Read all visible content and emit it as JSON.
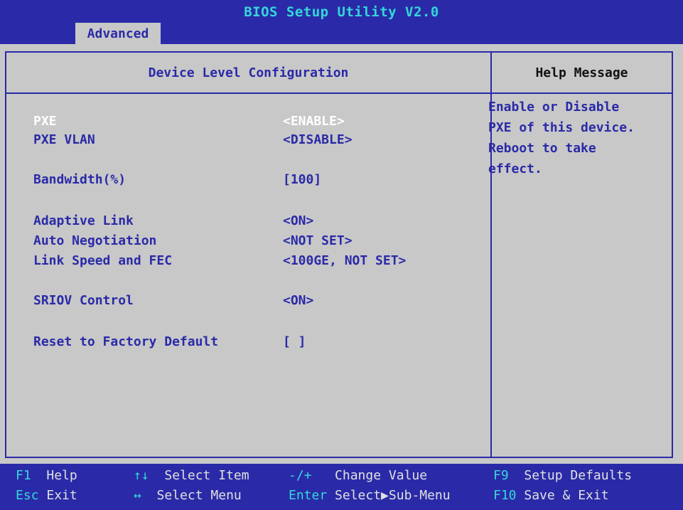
{
  "header": {
    "title": "BIOS Setup Utility V2.0",
    "active_tab": "Advanced"
  },
  "panel": {
    "title": "Device Level Configuration",
    "help_title": "Help Message",
    "help_lines": [
      "Enable or Disable",
      "PXE of this device.",
      "Reboot to take",
      "effect."
    ]
  },
  "settings": [
    {
      "label": "PXE",
      "value": "<ENABLE>"
    },
    {
      "label": "PXE VLAN",
      "value": "<DISABLE>"
    },
    {
      "label": "Bandwidth(%)",
      "value": "[100]"
    },
    {
      "label": "Adaptive Link",
      "value": "<ON>"
    },
    {
      "label": "Auto Negotiation",
      "value": "<NOT SET>"
    },
    {
      "label": "Link Speed and FEC",
      "value": "<100GE, NOT SET>"
    },
    {
      "label": "SRIOV Control",
      "value": "<ON>"
    },
    {
      "label": "Reset to Factory Default",
      "value": "[ ]"
    }
  ],
  "footer": [
    {
      "key": "F1",
      "desc": "Help"
    },
    {
      "key": "Esc",
      "desc": "Exit"
    },
    {
      "key": "↑↓",
      "desc": "Select Item"
    },
    {
      "key": "↔",
      "desc": "Select Menu"
    },
    {
      "key": "-/+",
      "desc": "Change Value"
    },
    {
      "key": "Enter",
      "desc": "Select▶Sub-Menu"
    },
    {
      "key": "F9",
      "desc": "Setup Defaults"
    },
    {
      "key": "F10",
      "desc": "Save & Exit"
    }
  ],
  "colors": {
    "background_blue": "#2a2aa8",
    "panel_gray": "#c8c8c8",
    "title_cyan": "#34d8d8",
    "selected_text": "#ffffff"
  }
}
